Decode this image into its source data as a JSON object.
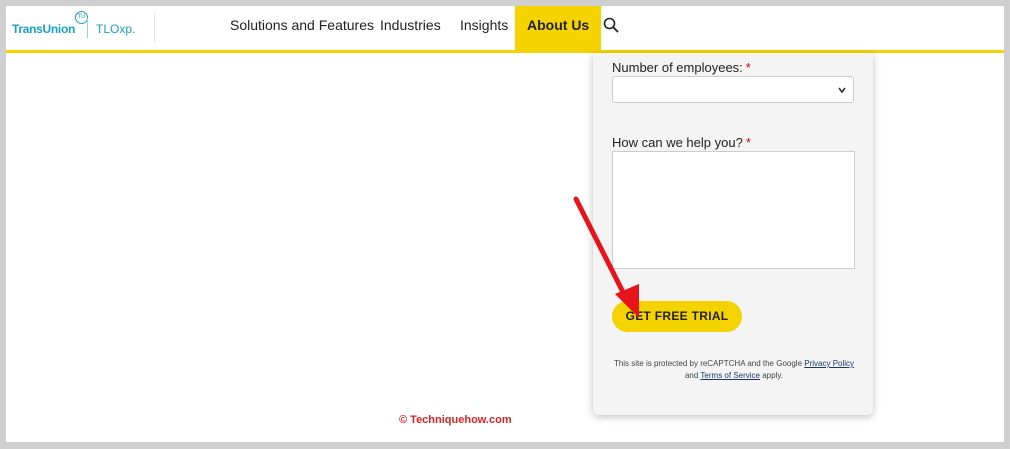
{
  "header": {
    "brand": "TransUnion",
    "brand_badge": "TU",
    "product": "TLOxp.",
    "nav": [
      "Solutions and Features",
      "Industries",
      "Insights",
      "About Us"
    ],
    "active_nav": "About Us",
    "search_icon": "search-icon"
  },
  "form": {
    "employees_label": "Number of employees:",
    "required_mark": "*",
    "help_label": "How can we help you?",
    "submit_label": "GET FREE TRIAL",
    "legal": {
      "text1": "This site is protected by reCAPTCHA and the Google",
      "privacy_link": "Privacy Policy",
      "text2": "and",
      "terms_link": "Terms of Service",
      "text3": "apply."
    }
  },
  "watermark": "© Techniquehow.com",
  "colors": {
    "accent": "#f5d300",
    "brand": "#1aa0c8",
    "arrow": "#e8141c"
  }
}
